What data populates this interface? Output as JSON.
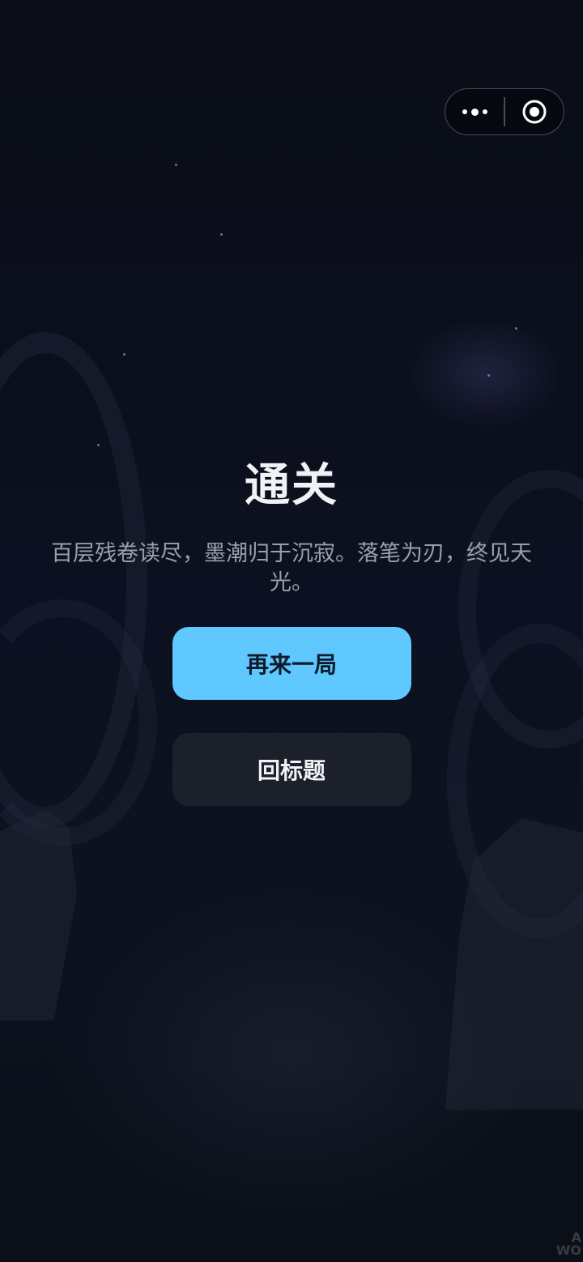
{
  "capsule": {
    "more_icon": "more-dots-icon",
    "close_icon": "record-circle-icon"
  },
  "result": {
    "title": "通关",
    "message": "百层残卷读尽，墨潮归于沉寂。落笔为刃，终见天光。"
  },
  "actions": {
    "replay_label": "再来一局",
    "back_to_title_label": "回标题"
  },
  "colors": {
    "background": "#0b0e18",
    "primary_button": "#5ec8ff",
    "primary_button_text": "#0e1a2a",
    "secondary_button": "#1c202b",
    "title_text": "#f1f2f5",
    "subtitle_text": "#9aa0ab"
  }
}
